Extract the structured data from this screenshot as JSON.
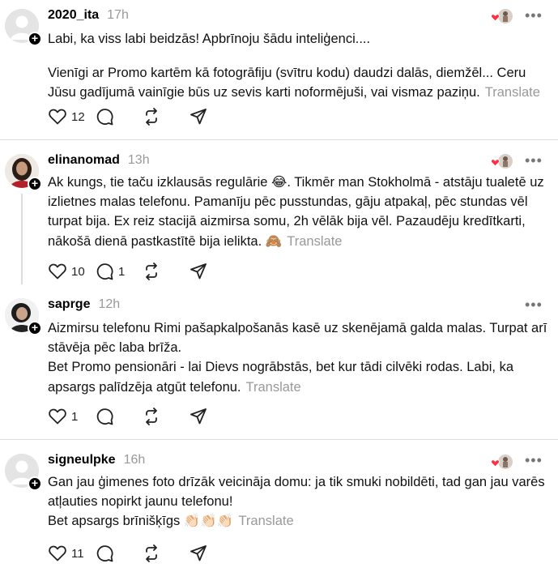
{
  "translate_label": "Translate",
  "posts": [
    {
      "username": "2020_ita",
      "time": "17h",
      "liked": true,
      "paragraphs": [
        "Labi, ka viss labi beidzās! Apbrīnoju šādu inteliģenci....",
        "Vienīgi ar Promo kartēm kā fotogrāfiju (svītru kodu) daudzi dalās, diemžēl... Ceru Jūsu gadījumā vainīgie būs uz sevis karti noformējuši, vai vismaz paziņu."
      ],
      "likes": "12",
      "replies": ""
    },
    {
      "username": "elinanomad",
      "time": "13h",
      "liked": true,
      "paragraphs": [
        "Ak kungs, tie taču izklausās regulārie 😂. Tikmēr man Stokholmā - atstāju tualetē uz izlietnes malas telefonu. Pamanīju pēc pusstundas, gāju atpakaļ, pēc stundas vēl turpat bija. Ex reiz stacijā aizmirsa somu, 2h vēlāk bija vēl. Pazaudēju kredītkarti, nākošā dienā pastkastītē bija ielikta. 🙈"
      ],
      "likes": "10",
      "replies": "1"
    },
    {
      "username": "saprge",
      "time": "12h",
      "liked": false,
      "paragraphs": [
        "Aizmirsu telefonu Rimi pašapkalpošanās kasē uz skenējamā galda malas. Turpat arī stāvēja pēc laba brīža.",
        "Bet Promo pensionāri - lai Dievs nogrābstās, bet kur tādi cilvēki rodas. Labi, ka apsargs palīdzēja atgūt telefonu."
      ],
      "likes": "1",
      "replies": ""
    },
    {
      "username": "signeulpke",
      "time": "16h",
      "liked": true,
      "paragraphs": [
        "Gan jau ģimenes foto drīzāk veicināja domu: ja tik smuki nobildēti, tad gan jau varēs atļauties nopirkt jaunu telefonu!",
        "Bet apsargs brīnišķīgs 👏🏻👏🏻👏🏻"
      ],
      "likes": "11",
      "replies": ""
    }
  ],
  "colors": {
    "heart": "#ff3040",
    "muted": "#999999",
    "divider": "#dedede"
  }
}
